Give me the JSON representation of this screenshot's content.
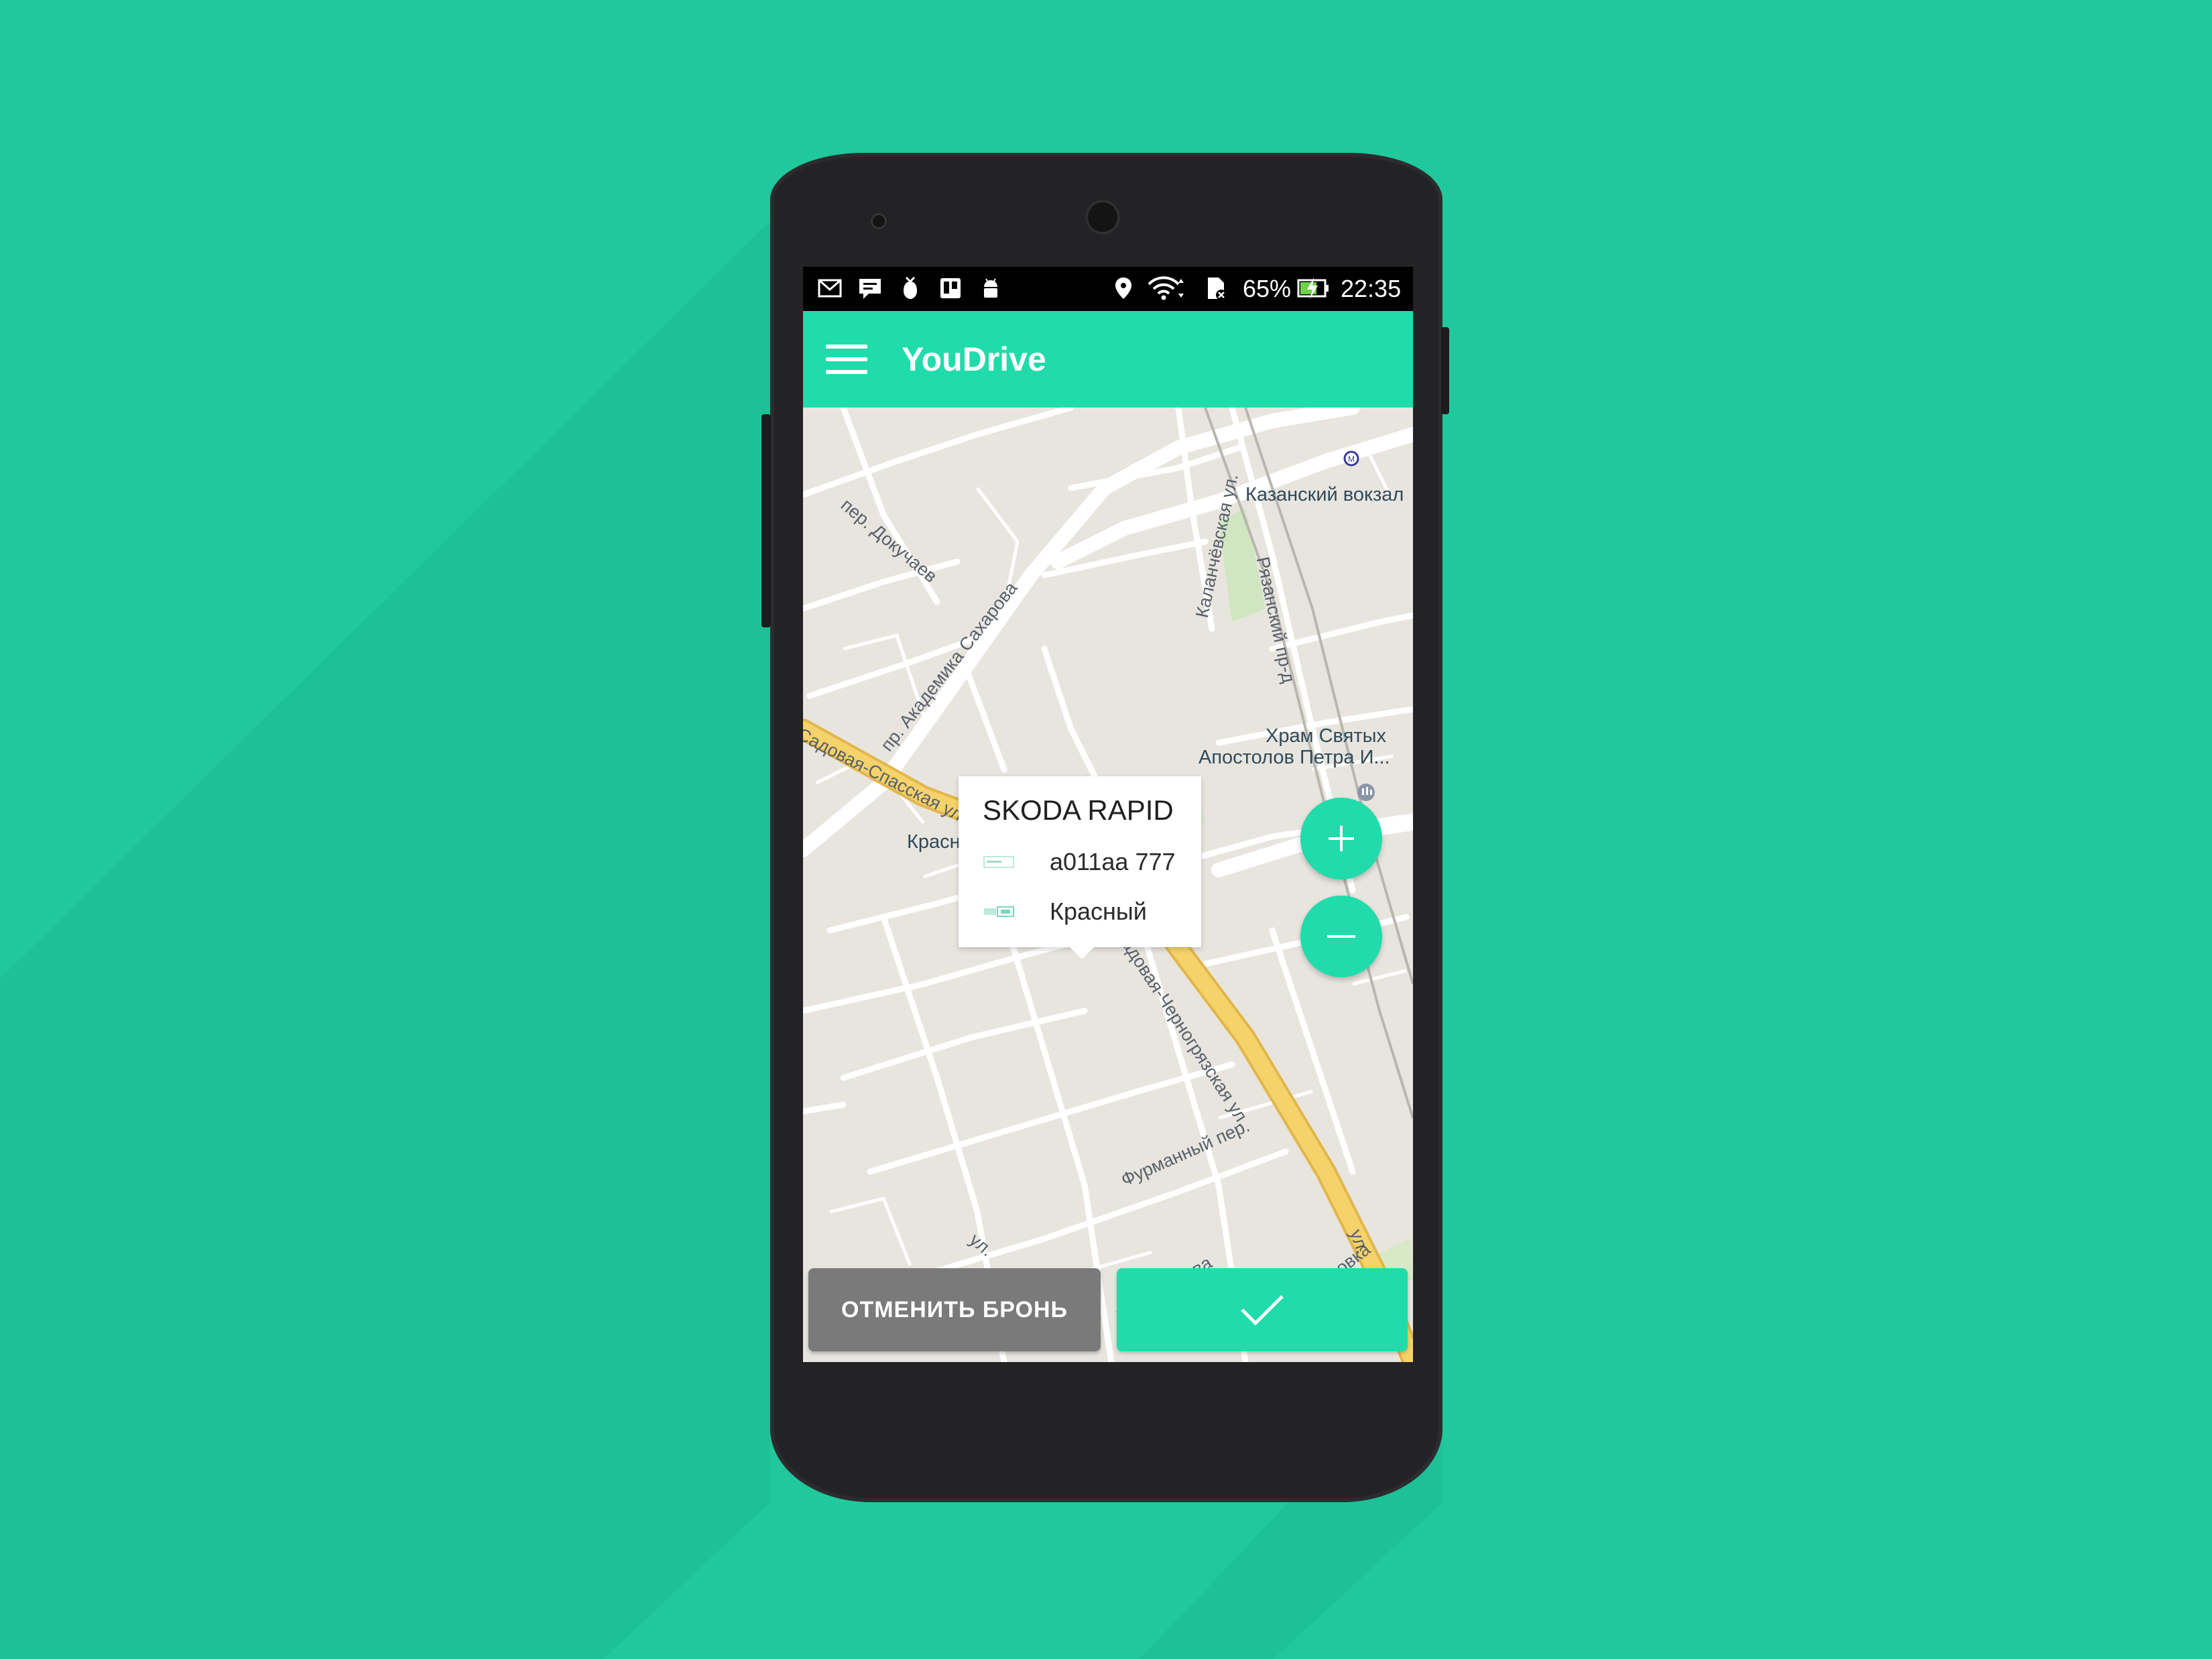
{
  "statusbar": {
    "icons": [
      "gmail-icon",
      "chat-icon",
      "notification-icon",
      "trello-icon",
      "android-icon",
      "location-icon",
      "wifi-icon",
      "sim-icon",
      "battery-icon"
    ],
    "battery_text": "65%",
    "time": "22:35"
  },
  "appbar": {
    "title": "YouDrive",
    "menu_icon": "hamburger-menu-icon"
  },
  "map": {
    "labels": {
      "kazansky": "Казанский вокзал",
      "dokuchaev": "пер. Докучаев",
      "sakharova": "пр. Академика Сахарова",
      "kalanchevskaya": "Каланчёвская ул.",
      "ryazansky": "Рязанский пр-д",
      "hram1": "Храм Святых",
      "hram2": "Апостолов Петра И...",
      "sadovaya_spasskaya": "Садовая-Спасская ул.",
      "krasnye_vorota": "Красные Ворота",
      "sadovaya_chernogryazskaya": "Садовая-Черногрязская ул.",
      "furmanny": "Фурманный пер.",
      "ul_mashkova": "ул. Машкова",
      "ul": "ул.",
      "ul_pokrovka": "ул. Покровка",
      "ul2": "ул."
    }
  },
  "car_callout": {
    "model": "SKODA RAPID",
    "plate": "a011aa 777",
    "color_name": "Красный",
    "plate_icon": "license-plate-icon",
    "color_icon": "car-color-icon"
  },
  "zoom": {
    "in_icon": "plus-icon",
    "out_icon": "minus-icon"
  },
  "actions": {
    "cancel_label": "ОТМЕНИТЬ БРОНЬ",
    "confirm_icon": "check-icon"
  },
  "colors": {
    "background": "#20c89b",
    "accent": "#20dcaa",
    "cancel_button": "#7a7a7a",
    "road_major": "#f5d26a",
    "marker": "#1e3a44"
  }
}
